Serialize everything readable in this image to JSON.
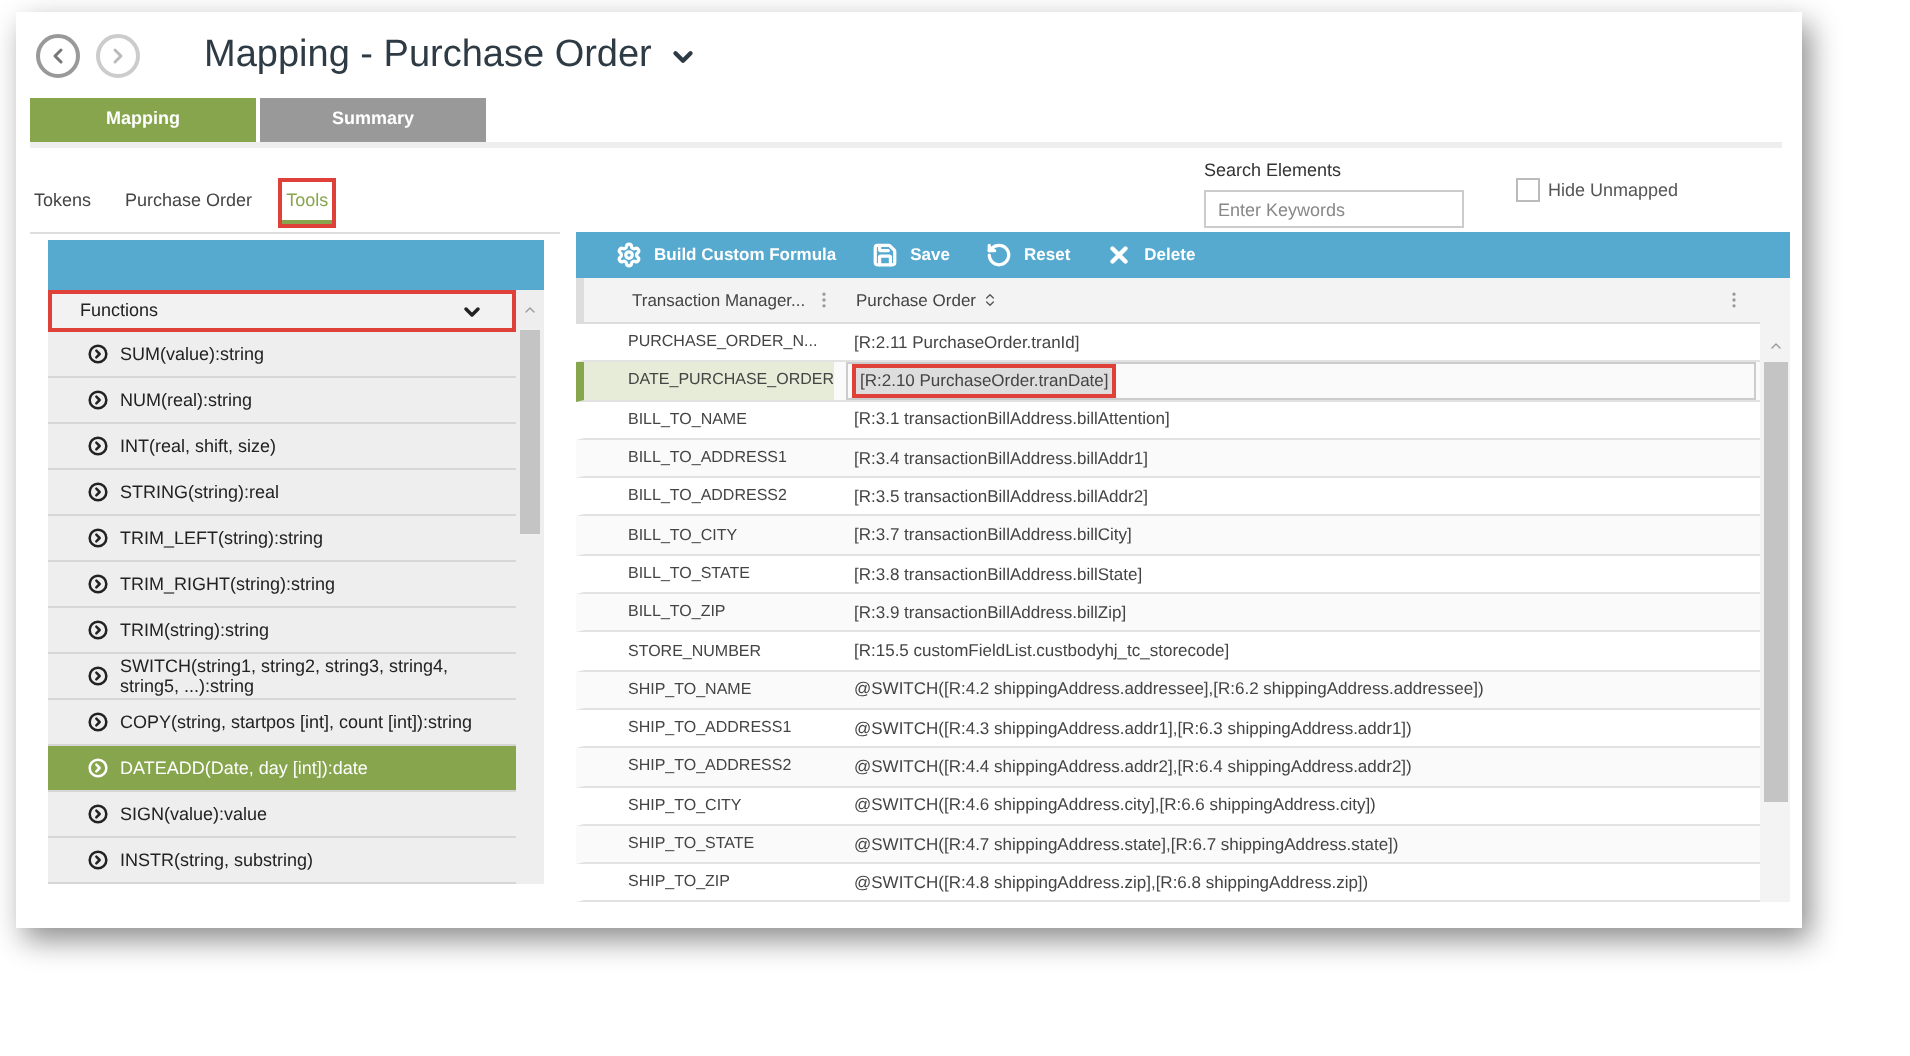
{
  "header": {
    "title": "Mapping - Purchase Order"
  },
  "main_tabs": [
    {
      "label": "Mapping",
      "selected": true
    },
    {
      "label": "Summary",
      "selected": false
    }
  ],
  "search": {
    "label": "Search Elements",
    "placeholder": "Enter Keywords"
  },
  "hide_unmapped": {
    "label": "Hide Unmapped",
    "checked": false
  },
  "sub_tabs": [
    {
      "label": "Tokens",
      "selected": false,
      "highlighted": false
    },
    {
      "label": "Purchase Order",
      "selected": false,
      "highlighted": false
    },
    {
      "label": "Tools",
      "selected": true,
      "highlighted": true
    }
  ],
  "functions_panel": {
    "dropdown": {
      "value": "Functions",
      "highlighted": true
    },
    "items": [
      {
        "label": "SUM(value):string",
        "selected": false
      },
      {
        "label": "NUM(real):string",
        "selected": false
      },
      {
        "label": "INT(real, shift, size)",
        "selected": false
      },
      {
        "label": "STRING(string):real",
        "selected": false
      },
      {
        "label": "TRIM_LEFT(string):string",
        "selected": false
      },
      {
        "label": "TRIM_RIGHT(string):string",
        "selected": false
      },
      {
        "label": "TRIM(string):string",
        "selected": false
      },
      {
        "label": "SWITCH(string1, string2, string3, string4, string5, ...):string",
        "selected": false
      },
      {
        "label": "COPY(string, startpos [int], count [int]):string",
        "selected": false
      },
      {
        "label": "DATEADD(Date, day [int]):date",
        "selected": true
      },
      {
        "label": "SIGN(value):value",
        "selected": false
      },
      {
        "label": "INSTR(string, substring)",
        "selected": false
      }
    ]
  },
  "toolbar": [
    {
      "label": "Build Custom Formula",
      "kind": "gear"
    },
    {
      "label": "Save",
      "kind": "save"
    },
    {
      "label": "Reset",
      "kind": "reset"
    },
    {
      "label": "Delete",
      "kind": "delete"
    }
  ],
  "table": {
    "columns": [
      "Transaction Manager...",
      "Purchase Order"
    ],
    "rows": [
      {
        "field": "PURCHASE_ORDER_N...",
        "mapping": "[R:2.11 PurchaseOrder.tranId]",
        "selected": false
      },
      {
        "field": "DATE_PURCHASE_ORDER",
        "mapping": "[R:2.10 PurchaseOrder.tranDate]",
        "selected": true
      },
      {
        "field": "BILL_TO_NAME",
        "mapping": "[R:3.1 transactionBillAddress.billAttention]",
        "selected": false
      },
      {
        "field": "BILL_TO_ADDRESS1",
        "mapping": "[R:3.4 transactionBillAddress.billAddr1]",
        "selected": false
      },
      {
        "field": "BILL_TO_ADDRESS2",
        "mapping": "[R:3.5 transactionBillAddress.billAddr2]",
        "selected": false
      },
      {
        "field": "BILL_TO_CITY",
        "mapping": "[R:3.7 transactionBillAddress.billCity]",
        "selected": false
      },
      {
        "field": "BILL_TO_STATE",
        "mapping": "[R:3.8 transactionBillAddress.billState]",
        "selected": false
      },
      {
        "field": "BILL_TO_ZIP",
        "mapping": "[R:3.9 transactionBillAddress.billZip]",
        "selected": false
      },
      {
        "field": "STORE_NUMBER",
        "mapping": "[R:15.5 customFieldList.custbodyhj_tc_storecode]",
        "selected": false
      },
      {
        "field": "SHIP_TO_NAME",
        "mapping": "@SWITCH([R:4.2 shippingAddress.addressee],[R:6.2 shippingAddress.addressee])",
        "selected": false
      },
      {
        "field": "SHIP_TO_ADDRESS1",
        "mapping": "@SWITCH([R:4.3 shippingAddress.addr1],[R:6.3 shippingAddress.addr1])",
        "selected": false
      },
      {
        "field": "SHIP_TO_ADDRESS2",
        "mapping": "@SWITCH([R:4.4 shippingAddress.addr2],[R:6.4 shippingAddress.addr2])",
        "selected": false
      },
      {
        "field": "SHIP_TO_CITY",
        "mapping": "@SWITCH([R:4.6 shippingAddress.city],[R:6.6 shippingAddress.city])",
        "selected": false
      },
      {
        "field": "SHIP_TO_STATE",
        "mapping": "@SWITCH([R:4.7 shippingAddress.state],[R:6.7 shippingAddress.state])",
        "selected": false
      },
      {
        "field": "SHIP_TO_ZIP",
        "mapping": "@SWITCH([R:4.8 shippingAddress.zip],[R:6.8 shippingAddress.zip])",
        "selected": false
      }
    ]
  }
}
